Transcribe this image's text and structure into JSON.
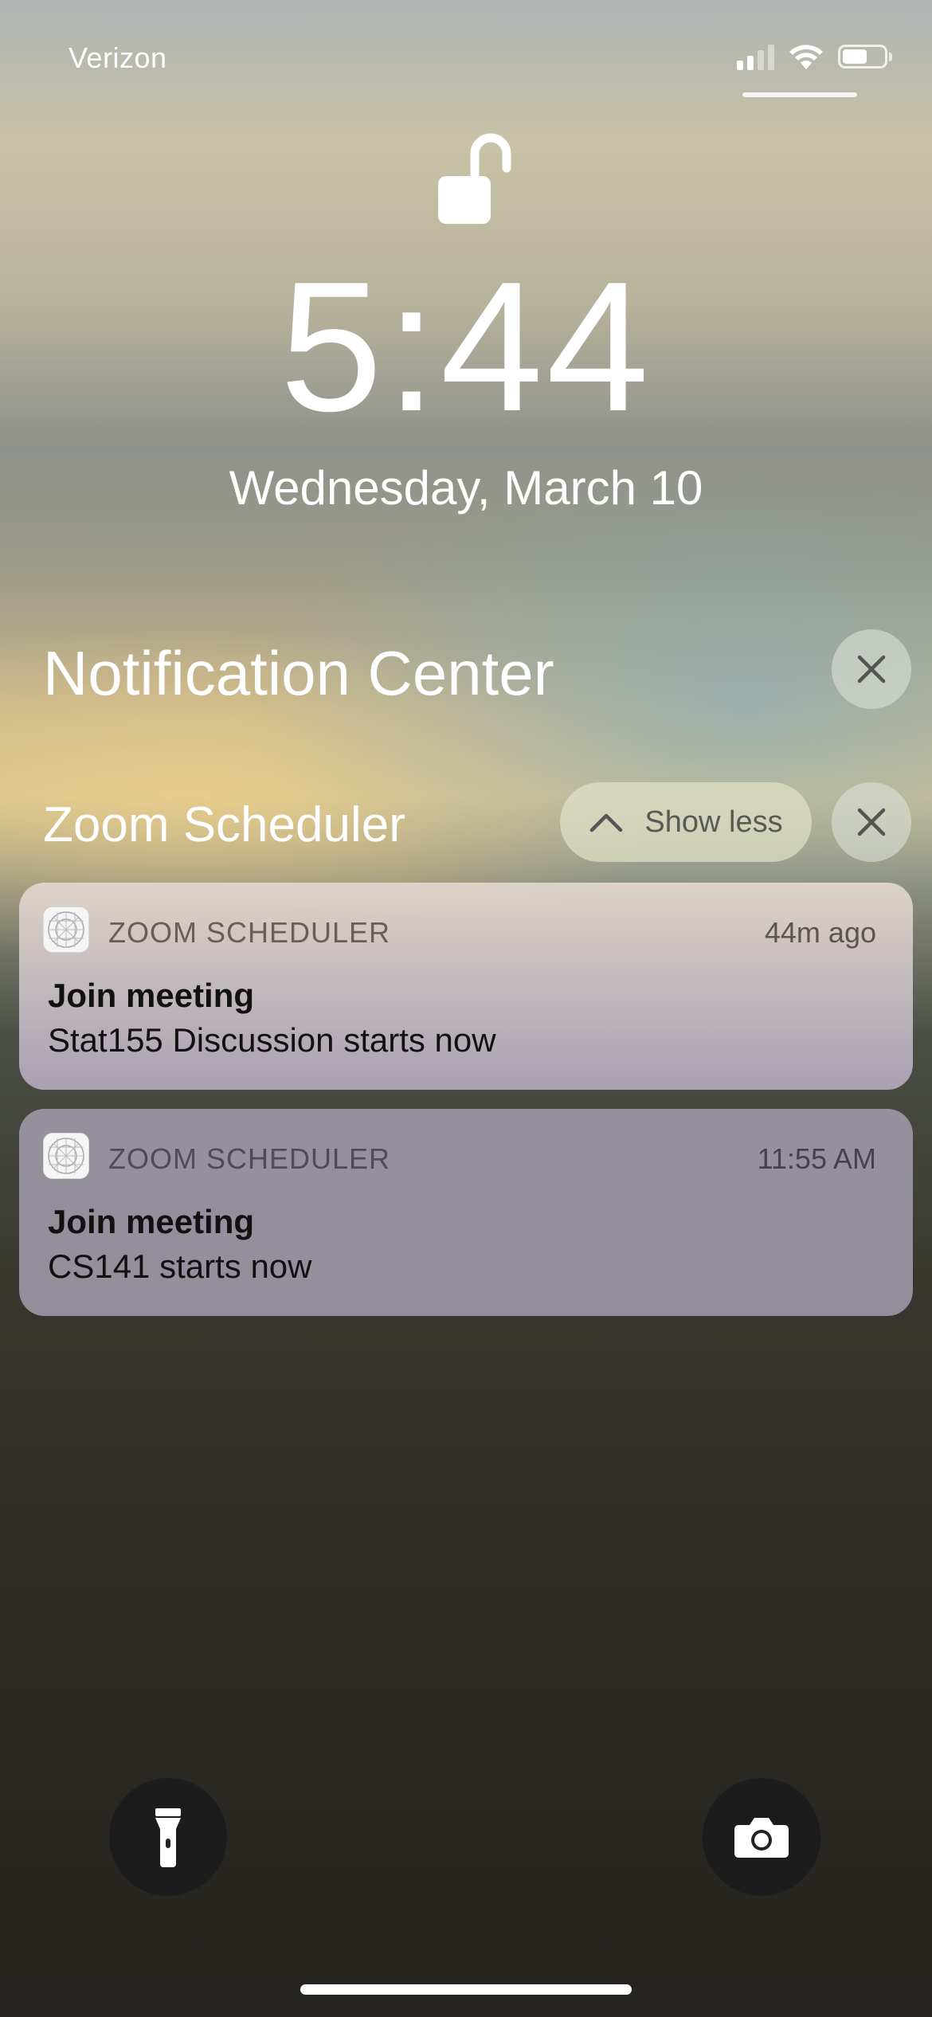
{
  "status_bar": {
    "carrier": "Verizon",
    "icons": [
      "signal-icon",
      "wifi-icon",
      "battery-icon"
    ]
  },
  "lock": {
    "icon": "unlocked-padlock-icon"
  },
  "clock": {
    "time": "5:44",
    "date": "Wednesday, March 10"
  },
  "notification_center": {
    "title": "Notification Center",
    "clear_icon": "close-icon"
  },
  "group": {
    "title": "Zoom Scheduler",
    "show_less_label": "Show less",
    "show_less_icon": "chevron-up-icon",
    "clear_icon": "close-icon"
  },
  "notifications": [
    {
      "app": "ZOOM SCHEDULER",
      "time": "44m ago",
      "title": "Join meeting",
      "body": "Stat155 Discussion starts now"
    },
    {
      "app": "ZOOM SCHEDULER",
      "time": "11:55 AM",
      "title": "Join meeting",
      "body": "CS141 starts now"
    }
  ],
  "quick_actions": [
    "flashlight-icon",
    "camera-icon"
  ]
}
